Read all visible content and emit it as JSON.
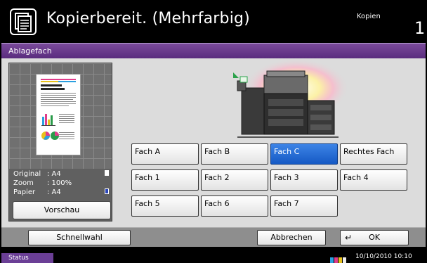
{
  "header": {
    "title": "Kopierbereit. (Mehrfarbig)",
    "mode_label": "Kopien",
    "copy_count": "1",
    "icon": "copy-document-icon"
  },
  "tab": {
    "title": "Ablagefach"
  },
  "left_panel": {
    "preview_icon": "document-preview",
    "info": [
      {
        "key": "Original",
        "value": ": A4"
      },
      {
        "key": "Zoom",
        "value": ": 100%"
      },
      {
        "key": "Papier",
        "value": ": A4"
      }
    ],
    "preview_button": "Vorschau"
  },
  "trays": {
    "row1": [
      "Fach A",
      "Fach B",
      "Fach C",
      "Rechtes Fach"
    ],
    "row2": [
      "Fach 1",
      "Fach 2",
      "Fach 3",
      "Fach 4"
    ],
    "row3": [
      "Fach 5",
      "Fach 6",
      "Fach 7"
    ],
    "selected": "Fach C"
  },
  "bottom": {
    "quick_setup": "Schnellwahl",
    "cancel": "Abbrechen",
    "ok": "OK"
  },
  "status": {
    "status_label": "Status",
    "datetime": "10/10/2010  10:10"
  },
  "colors": {
    "accent_purple": "#6b3f96",
    "selected_blue": "#1f66d1",
    "header_bg": "#000000"
  }
}
